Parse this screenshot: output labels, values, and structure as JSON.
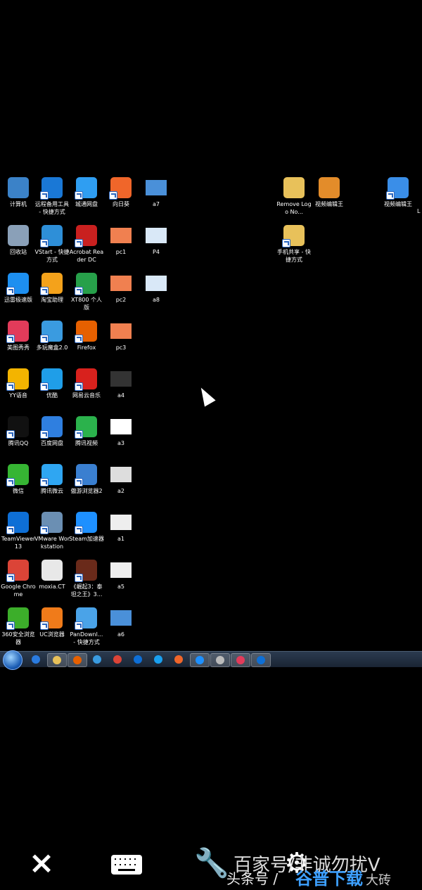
{
  "desktop": {
    "col1": [
      {
        "label": "计算机",
        "icon": "computer-icon",
        "color": "#3b82c8",
        "shortcut": false
      },
      {
        "label": "回收站",
        "icon": "recycle-bin-icon",
        "color": "#8aa0b8",
        "shortcut": false
      },
      {
        "label": "迅雷极速版",
        "icon": "thunder-icon",
        "color": "#1d8ff0",
        "shortcut": true
      },
      {
        "label": "美图秀秀",
        "icon": "meitu-icon",
        "color": "#e23b5a",
        "shortcut": true
      },
      {
        "label": "YY语音",
        "icon": "yy-icon",
        "color": "#f3b400",
        "shortcut": true
      },
      {
        "label": "腾讯QQ",
        "icon": "qq-icon",
        "color": "#111111",
        "shortcut": true
      },
      {
        "label": "微信",
        "icon": "wechat-icon",
        "color": "#36b533",
        "shortcut": true
      },
      {
        "label": "TeamViewer 13",
        "icon": "teamviewer-icon",
        "color": "#0e6fd6",
        "shortcut": true
      },
      {
        "label": "Google Chrome",
        "icon": "chrome-icon",
        "color": "#db4437",
        "shortcut": true
      },
      {
        "label": "360安全浏览器",
        "icon": "360-browser-icon",
        "color": "#3cae2a",
        "shortcut": true
      }
    ],
    "col2": [
      {
        "label": "远程备用工具 - 快捷方式",
        "icon": "teamviewer-icon",
        "color": "#1a78d6",
        "shortcut": true
      },
      {
        "label": "VStart - 快捷方式",
        "icon": "vstart-icon",
        "color": "#2e8fd8",
        "shortcut": true
      },
      {
        "label": "淘宝助理",
        "icon": "taobao-icon",
        "color": "#f4a21b",
        "shortcut": true
      },
      {
        "label": "多玩魔盒2.0",
        "icon": "duowan-icon",
        "color": "#3a9be0",
        "shortcut": true
      },
      {
        "label": "优酷",
        "icon": "youku-icon",
        "color": "#1f9ee8",
        "shortcut": true
      },
      {
        "label": "百度网盘",
        "icon": "baidu-netdisk-icon",
        "color": "#2f7fe0",
        "shortcut": true
      },
      {
        "label": "腾讯微云",
        "icon": "weiyun-icon",
        "color": "#2fa6f2",
        "shortcut": true
      },
      {
        "label": "VMware Workstation",
        "icon": "vmware-icon",
        "color": "#6b8fb3",
        "shortcut": true
      },
      {
        "label": "moxia.CT",
        "icon": "file-icon",
        "color": "#e8e8e8",
        "shortcut": false
      },
      {
        "label": "UC浏览器",
        "icon": "uc-browser-icon",
        "color": "#f07b1a",
        "shortcut": true
      }
    ],
    "col3": [
      {
        "label": "城通网盘",
        "icon": "cloud-icon",
        "color": "#2f9ef2",
        "shortcut": true
      },
      {
        "label": "Acrobat Reader DC",
        "icon": "acrobat-icon",
        "color": "#c9201f",
        "shortcut": true
      },
      {
        "label": "XT800 个人版",
        "icon": "xt800-icon",
        "color": "#27a04a",
        "shortcut": true
      },
      {
        "label": "Firefox",
        "icon": "firefox-icon",
        "color": "#e66000",
        "shortcut": true
      },
      {
        "label": "网易云音乐",
        "icon": "netease-music-icon",
        "color": "#d8211d",
        "shortcut": true
      },
      {
        "label": "腾讯视频",
        "icon": "tencent-video-icon",
        "color": "#2bb24c",
        "shortcut": true
      },
      {
        "label": "傲游浏览器2",
        "icon": "maxthon-icon",
        "color": "#3a7fd0",
        "shortcut": true
      },
      {
        "label": "Steam加速器",
        "icon": "steam-accelerator-icon",
        "color": "#1e90ff",
        "shortcut": true
      },
      {
        "label": "《崛起3：泰坦之王》3...",
        "icon": "game-icon",
        "color": "#6a2a1a",
        "shortcut": true
      },
      {
        "label": "PanDownl... - 快捷方式",
        "icon": "pandownload-icon",
        "color": "#4aa3e8",
        "shortcut": true
      }
    ],
    "col4": [
      {
        "label": "向日葵",
        "icon": "sunflower-icon",
        "color": "#f0662a",
        "shortcut": true
      },
      {
        "label": "pc1",
        "icon": "image-thumb-icon",
        "color": "#f08050",
        "shortcut": false
      },
      {
        "label": "pc2",
        "icon": "image-thumb-icon",
        "color": "#f08050",
        "shortcut": false
      },
      {
        "label": "pc3",
        "icon": "image-thumb-icon",
        "color": "#f08050",
        "shortcut": false
      },
      {
        "label": "a4",
        "icon": "image-thumb-icon",
        "color": "#333333",
        "shortcut": false
      },
      {
        "label": "a3",
        "icon": "image-thumb-icon",
        "color": "#ffffff",
        "shortcut": false
      },
      {
        "label": "a2",
        "icon": "image-thumb-icon",
        "color": "#dddddd",
        "shortcut": false
      },
      {
        "label": "a1",
        "icon": "image-thumb-icon",
        "color": "#eeeeee",
        "shortcut": false
      },
      {
        "label": "a5",
        "icon": "image-thumb-icon",
        "color": "#eeeeee",
        "shortcut": false
      },
      {
        "label": "a6",
        "icon": "image-thumb-icon",
        "color": "#4a90d9",
        "shortcut": false
      }
    ],
    "col5": [
      {
        "label": "a7",
        "icon": "image-thumb-icon",
        "color": "#4a90d9",
        "shortcut": false
      },
      {
        "label": "P4",
        "icon": "image-thumb-icon",
        "color": "#d9e8f7",
        "shortcut": false
      },
      {
        "label": "a8",
        "icon": "image-thumb-icon",
        "color": "#d9e8f7",
        "shortcut": false
      }
    ],
    "right": [
      {
        "label": "Remove Logo No...",
        "icon": "folder-icon",
        "color": "#e8c15a",
        "shortcut": false
      },
      {
        "label": "视频编辑王",
        "icon": "video-editor-icon",
        "color": "#e38c2a",
        "shortcut": false
      },
      {
        "label": "视频编辑王",
        "icon": "video-editor-icon",
        "color": "#3a8ee8",
        "shortcut": true
      },
      {
        "label": "手机共享 - 快捷方式",
        "icon": "folder-icon",
        "color": "#e8c15a",
        "shortcut": true
      }
    ],
    "extra_label": "L"
  },
  "taskbar": {
    "buttons": [
      {
        "name": "ie-taskbar-icon",
        "color": "#2a7be0"
      },
      {
        "name": "explorer-taskbar-icon",
        "color": "#e8c15a"
      },
      {
        "name": "firefox-taskbar-icon",
        "color": "#e66000"
      },
      {
        "name": "duowan-taskbar-icon",
        "color": "#3a9be0"
      },
      {
        "name": "chrome-taskbar-icon",
        "color": "#db4437"
      },
      {
        "name": "teamviewer-taskbar-icon",
        "color": "#0e6fd6"
      },
      {
        "name": "qq-taskbar-icon",
        "color": "#1aa0f0"
      },
      {
        "name": "sunflower-taskbar-icon",
        "color": "#f0662a"
      },
      {
        "name": "media-taskbar-icon",
        "color": "#1e90ff"
      },
      {
        "name": "app-taskbar-icon",
        "color": "#bbbbbb"
      },
      {
        "name": "meitu-taskbar-icon",
        "color": "#e23b5a"
      },
      {
        "name": "teamviewer2-taskbar-icon",
        "color": "#0e6fd6"
      }
    ]
  },
  "bottom_bar": {
    "close_icon": "×",
    "keyboard_icon": "keyboard-icon",
    "tools_icon": "wrench-icon",
    "settings_icon": "gear-icon"
  },
  "watermark": {
    "line1": "百家号/非诚勿扰V",
    "line2": "头条号 / ",
    "brand": "谷普下载",
    "suffix": "大砖"
  }
}
